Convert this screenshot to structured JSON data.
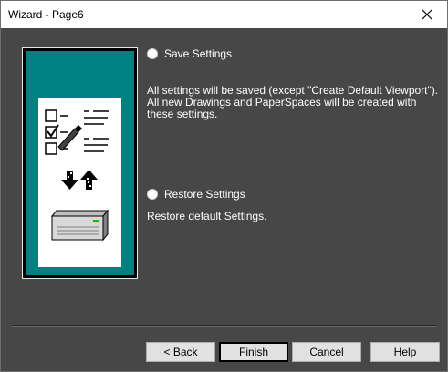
{
  "window": {
    "title": "Wizard - Page6"
  },
  "options": {
    "save": {
      "label": "Save Settings",
      "description": "All settings will be saved (except \"Create Default Viewport\").\nAll new Drawings and PaperSpaces will be created with\nthese settings."
    },
    "restore": {
      "label": "Restore Settings",
      "description": "Restore default Settings."
    }
  },
  "buttons": {
    "back": "< Back",
    "finish": "Finish",
    "cancel": "Cancel",
    "help": "Help"
  },
  "icons": {
    "close": "close-icon",
    "checklist": "checklist-icon",
    "transfer": "transfer-arrows-icon",
    "device": "disk-drive-icon"
  },
  "colors": {
    "window_background": "#474747",
    "illustration_background": "#008080",
    "titlebar": "#ffffff"
  }
}
